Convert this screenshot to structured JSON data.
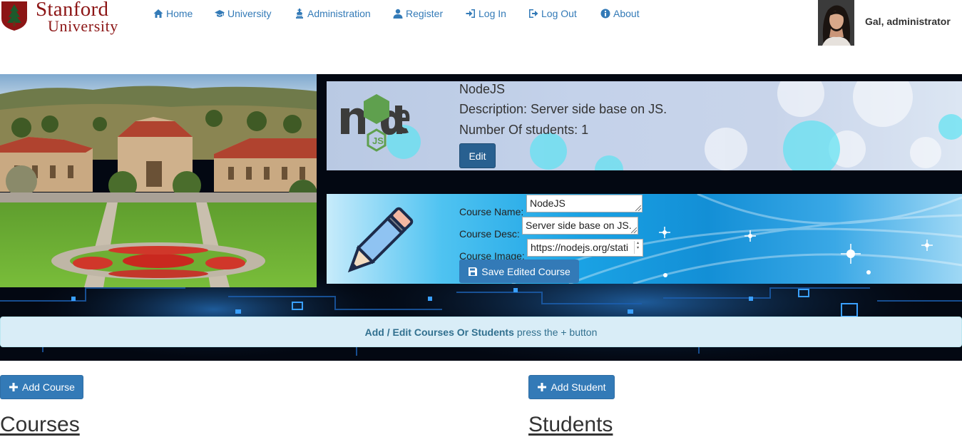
{
  "brand": {
    "name_line1": "Stanford",
    "name_line2": "University",
    "seal_icon": "stanford-tree-seal-icon",
    "color": "#8c1515"
  },
  "nav": {
    "items": [
      {
        "label": "Home",
        "icon": "home-icon"
      },
      {
        "label": "University",
        "icon": "graduation-cap-icon"
      },
      {
        "label": "Administration",
        "icon": "king-icon"
      },
      {
        "label": "Register",
        "icon": "user-icon"
      },
      {
        "label": "Log In",
        "icon": "log-in-icon"
      },
      {
        "label": "Log Out",
        "icon": "log-out-icon"
      },
      {
        "label": "About",
        "icon": "info-icon"
      }
    ],
    "link_color": "#337ab7"
  },
  "user": {
    "display": "Gal, administrator"
  },
  "course_card": {
    "name": "NodeJS",
    "description": "Description: Server side base on JS.",
    "students": "Number Of students: 1",
    "edit_label": "Edit",
    "logo_icon": "nodejs-logo-icon"
  },
  "edit_form": {
    "name_label": "Course Name:",
    "name_value": "NodeJS",
    "desc_label": "Course Desc:",
    "desc_value": "Server side base on JS.",
    "image_label": "Course Image:",
    "image_value": "https://nodejs.org/stati",
    "save_label": "Save Edited Course",
    "save_icon": "save-icon",
    "pencil_icon": "pencil-icon"
  },
  "info_bar": {
    "bold": "Add / Edit Courses Or Students",
    "rest": "press the + button"
  },
  "actions": {
    "add_course": "Add Course",
    "add_student": "Add Student",
    "plus_icon": "plus-icon"
  },
  "sections": {
    "courses": "Courses",
    "students": "Students"
  }
}
